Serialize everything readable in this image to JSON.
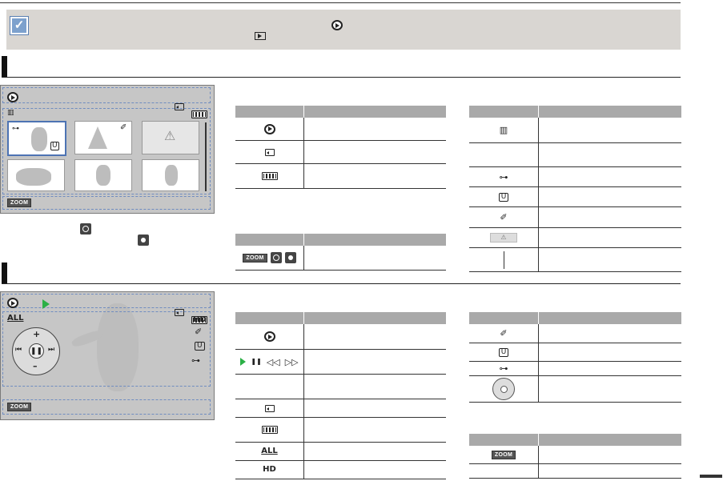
{
  "note": {
    "check_icon": "checkbox-note-icon"
  },
  "section1": {
    "title": ""
  },
  "section2": {
    "title": ""
  },
  "screen1": {
    "zoom_label": "ZOOM",
    "icons": [
      "photo-play-mode-icon",
      "memory-card-icon",
      "battery-icon",
      "info-icon",
      "protect-key-icon",
      "upload-icon",
      "share-icon",
      "warning-icon",
      "nav-dial-icon",
      "ok-icon"
    ]
  },
  "screen2": {
    "zoom_label": "ZOOM",
    "icons": [
      "photo-play-mode-icon",
      "play-icon",
      "memory-card-icon",
      "battery-icon",
      "all-icon",
      "hd-icon",
      "share-icon",
      "upload-icon",
      "protect-key-icon",
      "control-wheel-icon"
    ]
  },
  "tables": {
    "t1_rows": 3,
    "t2_rows": 1,
    "t3_rows": 6,
    "t4_rows": 6,
    "t5_rows": 4,
    "t6_rows": 2,
    "zoom_cell": "ZOOM"
  },
  "colors": {
    "accent_blue": "#6f8cc0",
    "play_green": "#2bb046",
    "header_gray": "#a9a9a9",
    "note_bg": "#d9d6d2"
  }
}
